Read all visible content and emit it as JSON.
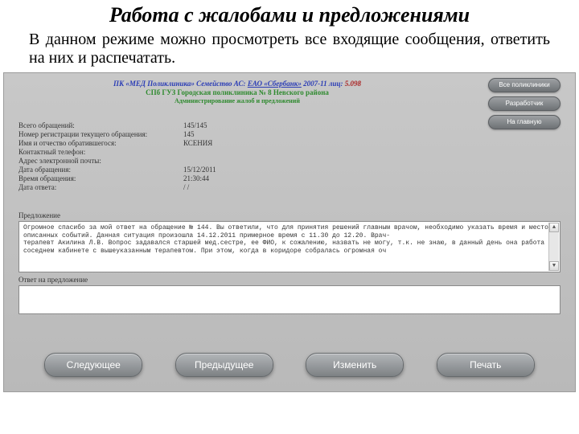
{
  "title": "Работа с жалобами и предложениями",
  "intro": "В данном режиме можно просмотреть все входящие сообщения, ответить на них и распечатать.",
  "app": {
    "header": {
      "line1_prefix": "ПК «МЕД Поликлиника» Семейство АС: ",
      "line1_quoted": "ЕАО «Сбербанк»",
      "line1_suffix": " 2007-11 лиц: ",
      "line1_lic": "5.098",
      "line2": "СПб ГУЗ Городская поликлиника № 8 Невского района",
      "line3": "Администрирование жалоб и предложений"
    },
    "topbtns": {
      "all": "Все поликлиники",
      "dev": "Разработчик",
      "home": "На главную"
    },
    "fields": [
      {
        "label": "Всего обращений:",
        "value": "145/145"
      },
      {
        "label": "Номер регистрации текущего обращения:",
        "value": "145"
      },
      {
        "label": "Имя и отчество обратившегося:",
        "value": "КСЕНИЯ"
      },
      {
        "label": "Контактный телефон:",
        "value": ""
      },
      {
        "label": "Адрес электронной почты:",
        "value": ""
      },
      {
        "label": "Дата обращения:",
        "value": "15/12/2011"
      },
      {
        "label": "Время обращения:",
        "value": "21:30:44"
      },
      {
        "label": "Дата ответа:",
        "value": "/ /"
      }
    ],
    "msg_label": "Предложение",
    "msg_text": "Огромное спасибо за мой ответ на обращение № 144. Вы ответили, что для принятия решений главным врачом, необходимо указать время и место описанных событий. Данная ситуация произошла 14.12.2011 примерное время с 11.30 до 12.20. Врач-\nтерапевт Акилина Л.В. Вопрос задавался старшей мед.сестре, ее ФИО, к сожалению, назвать не могу, т.к. не знаю, в данный день она работа в соседнем кабинете с вышеуказанным терапевтом. При этом, когда в коридоре собралась огромная оч",
    "reply_label": "Ответ на предложение",
    "botbtns": {
      "next": "Следующее",
      "prev": "Предыдущее",
      "edit": "Изменить",
      "print": "Печать"
    }
  }
}
